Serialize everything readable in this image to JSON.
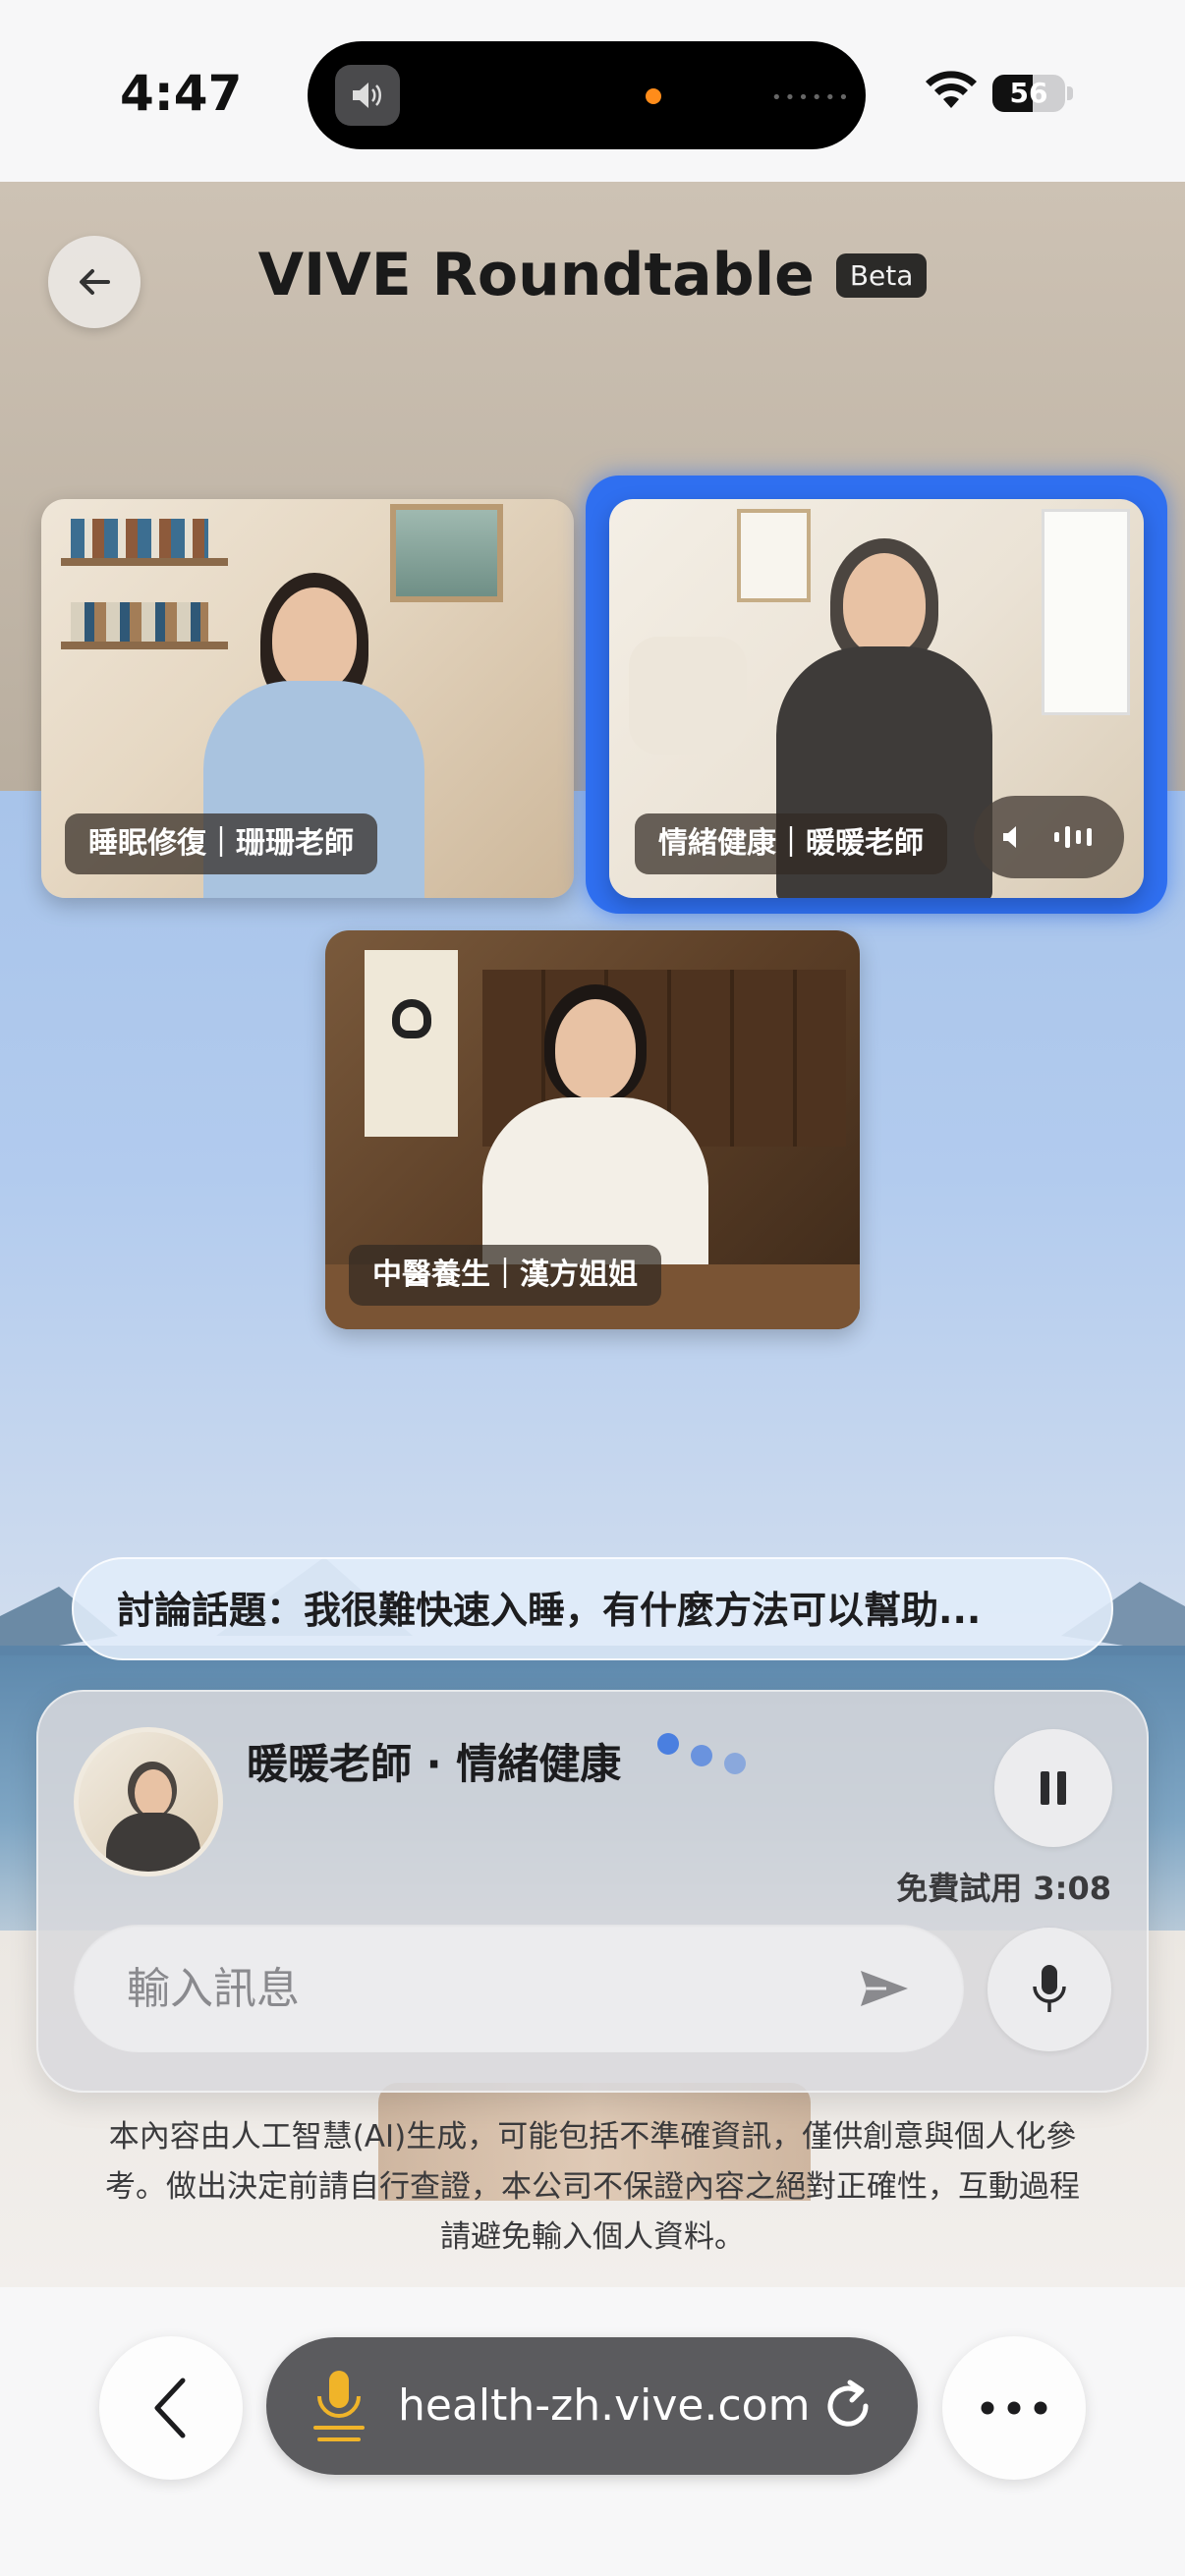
{
  "status_bar": {
    "time": "4:47",
    "battery_level": "56",
    "battery_fraction": 0.56
  },
  "header": {
    "title": "VIVE Roundtable",
    "badge": "Beta"
  },
  "participants": [
    {
      "label": "睡眠修復｜珊珊老師",
      "active": false
    },
    {
      "label": "情緒健康｜暖暖老師",
      "active": true
    },
    {
      "label": "中醫養生｜漢方姐姐",
      "active": false
    }
  ],
  "topic": {
    "text": "討論話題：我很難快速入睡，有什麼方法可以幫助..."
  },
  "chat_panel": {
    "speaker": "暖暖老師 · 情緒健康",
    "trial_text": "免費試用 3:08",
    "input_placeholder": "輸入訊息",
    "input_value": ""
  },
  "disclaimer": "本內容由人工智慧(AI)生成，可能包括不準確資訊，僅供創意與個人化參考。做出決定前請自行查證，本公司不保證內容之絕對正確性，互動過程請避免輸入個人資料。",
  "browser": {
    "url": "health-zh.vive.com"
  },
  "colors": {
    "active_border": "#2f6ff0",
    "typing_dot": "#4a7fe0",
    "battery_fill": "#111111"
  },
  "icons": {
    "back": "arrow-left-icon",
    "pause": "pause-icon",
    "send": "send-icon",
    "mic": "mic-icon",
    "reload": "reload-icon",
    "more": "ellipsis-icon",
    "speaker": "speaker-icon"
  }
}
